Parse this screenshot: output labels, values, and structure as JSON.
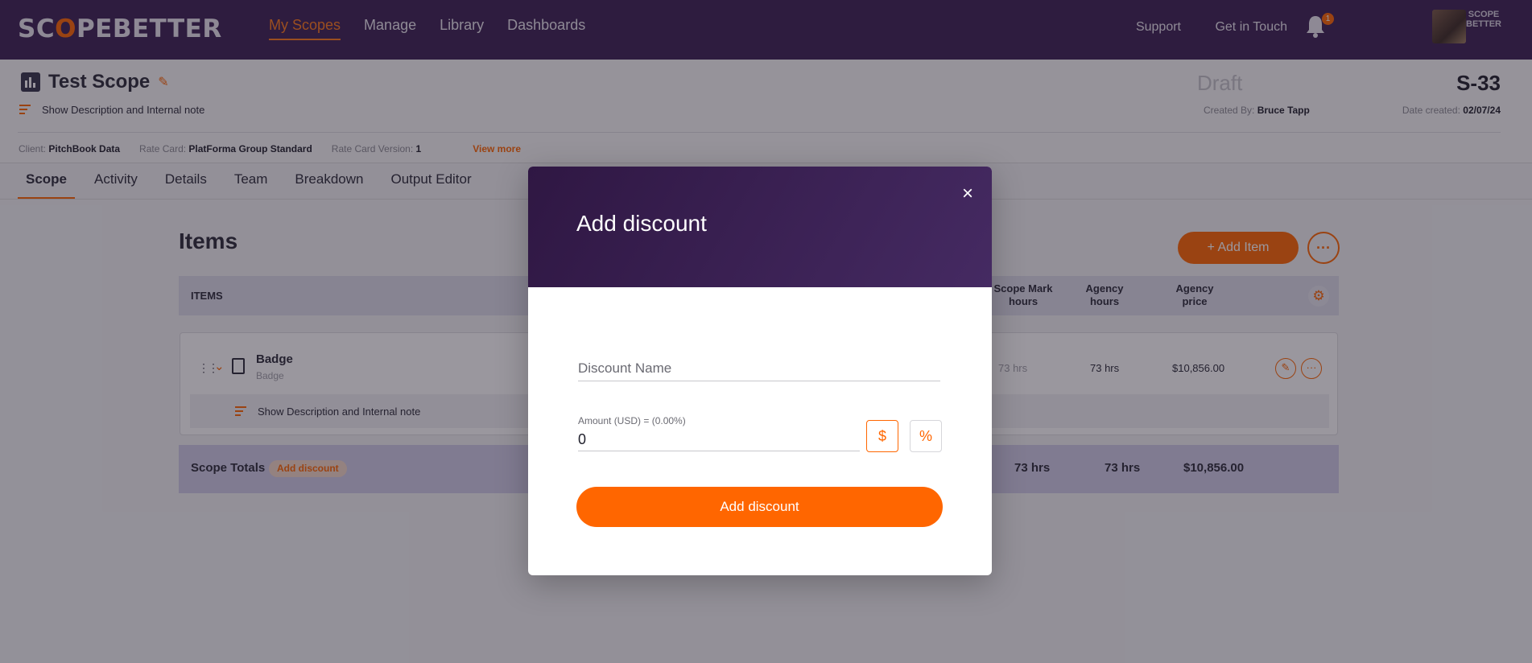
{
  "brand": {
    "logo_text": "SCOPEBETTER",
    "mini_logo": "SCOPE BETTER",
    "accent": "#ff6600",
    "header_bg": "#3b1f52"
  },
  "nav": {
    "items": [
      "My Scopes",
      "Manage",
      "Library",
      "Dashboards"
    ],
    "active": "My Scopes"
  },
  "topright": {
    "support": "Support",
    "get_in_touch": "Get in Touch",
    "notifications_count": "1"
  },
  "scope": {
    "title": "Test Scope",
    "show_description": "Show Description and Internal note",
    "status": "Draft",
    "number": "S-33",
    "created_by_label": "Created By:",
    "created_by": "Bruce Tapp",
    "date_created_label": "Date created:",
    "date_created": "02/07/24",
    "client_label": "Client:",
    "client": "PitchBook Data",
    "rate_card_label": "Rate Card:",
    "rate_card": "PlatForma Group Standard",
    "rate_card_version_label": "Rate Card Version:",
    "rate_card_version": "1",
    "view_more": "View more"
  },
  "tabs": [
    "Scope",
    "Activity",
    "Details",
    "Team",
    "Breakdown",
    "Output Editor"
  ],
  "items_section": {
    "title": "Items",
    "add_item": "+ Add Item",
    "more_label": "···",
    "columns": {
      "items": "ITEMS",
      "scope_mark_hours": "Scope Mark hours",
      "agency_hours": "Agency hours",
      "agency_price": "Agency price"
    },
    "rows": [
      {
        "name": "Badge",
        "subtitle": "Badge",
        "scope_mark_hours": "73 hrs",
        "agency_hours": "73 hrs",
        "agency_price": "$10,856.00",
        "show_description": "Show Description and Internal note"
      }
    ],
    "totals": {
      "label": "Scope Totals",
      "add_discount": "Add discount",
      "scope_mark_hours": "73 hrs",
      "agency_hours": "73 hrs",
      "agency_price": "$10,856.00"
    }
  },
  "modal": {
    "title": "Add discount",
    "close": "×",
    "name_placeholder": "Discount Name",
    "amount_label": "Amount (USD) = (0.00%)",
    "amount_value": "0",
    "dollar": "$",
    "percent": "%",
    "submit": "Add discount"
  }
}
